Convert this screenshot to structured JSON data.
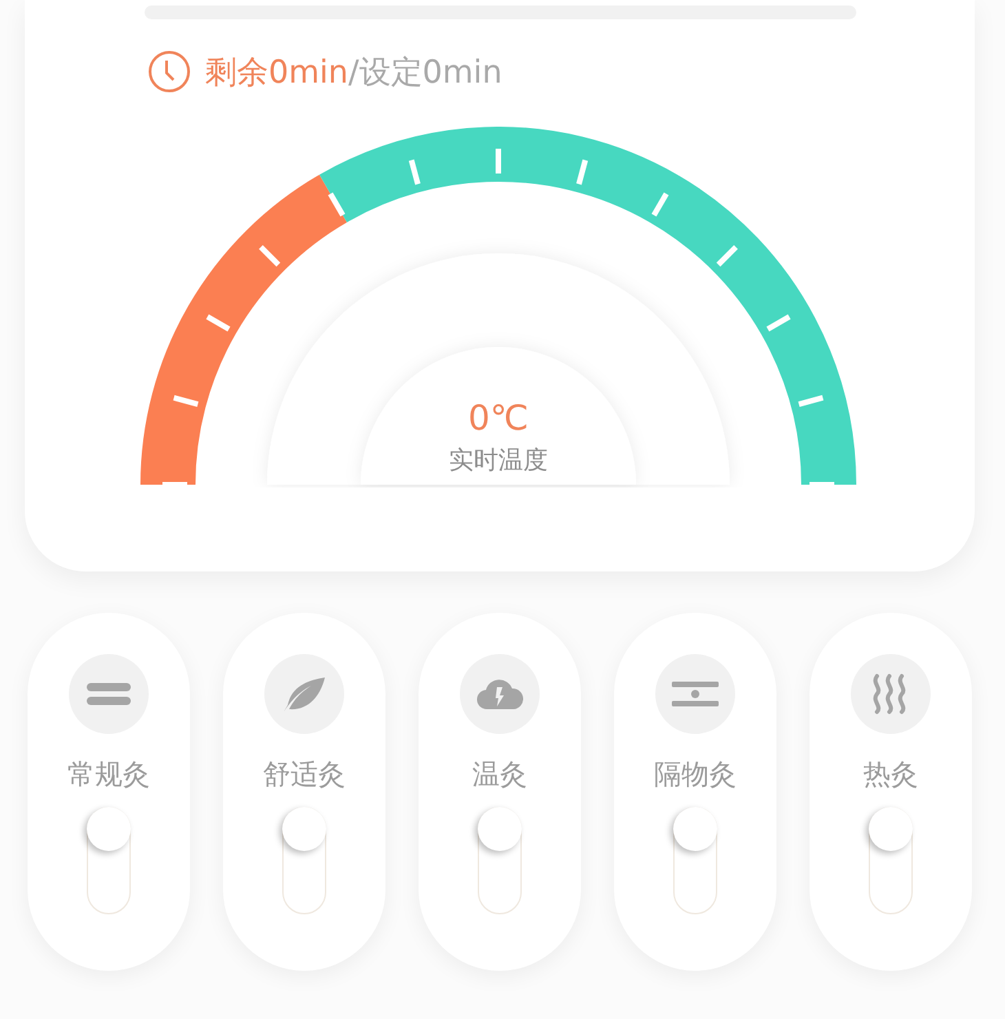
{
  "timer": {
    "remaining": "剩余0min",
    "separator": "/",
    "set": "设定0min"
  },
  "gauge": {
    "value": "0℃",
    "label": "实时温度"
  },
  "modes": [
    {
      "kind": "lines",
      "label": "常规灸",
      "on": false
    },
    {
      "kind": "leaf",
      "label": "舒适灸",
      "on": false
    },
    {
      "kind": "cloud",
      "label": "温灸",
      "on": false
    },
    {
      "kind": "barrier",
      "label": "隔物灸",
      "on": false
    },
    {
      "kind": "heat",
      "label": "热灸",
      "on": false
    }
  ]
}
